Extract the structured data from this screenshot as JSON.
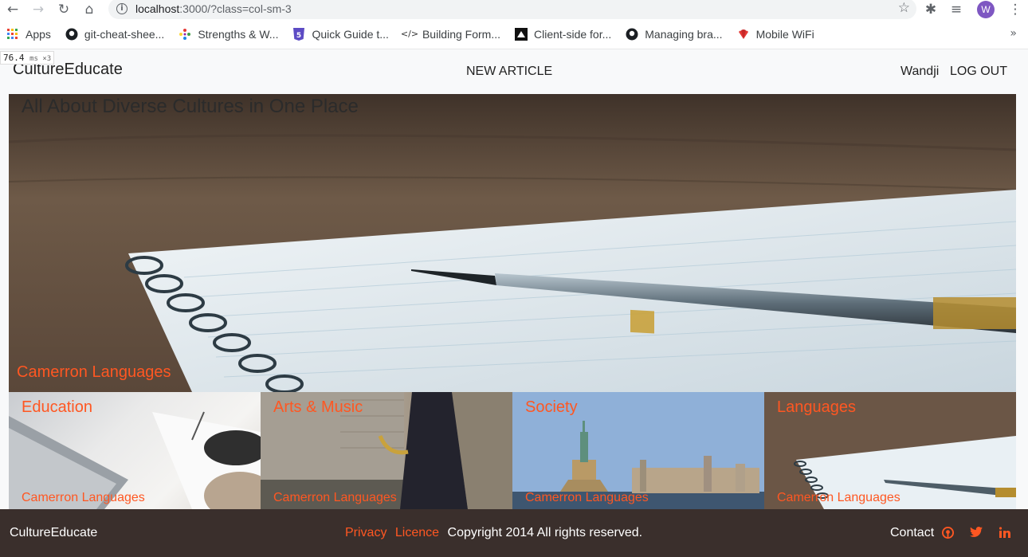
{
  "browser": {
    "url_host": "localhost",
    "url_path": ":3000/?class=col-sm-3",
    "avatar_letter": "W",
    "bookmarks": [
      {
        "label": "Apps",
        "icon": "apps-grid-icon"
      },
      {
        "label": "git-cheat-shee...",
        "icon": "github-icon"
      },
      {
        "label": "Strengths & W...",
        "icon": "colorful-dots-icon"
      },
      {
        "label": "Quick Guide t...",
        "icon": "html5-icon"
      },
      {
        "label": "Building Form...",
        "icon": "code-icon"
      },
      {
        "label": "Client-side for...",
        "icon": "mdn-icon"
      },
      {
        "label": "Managing bra...",
        "icon": "github-icon"
      },
      {
        "label": "Mobile WiFi",
        "icon": "huawei-icon"
      }
    ]
  },
  "timing": {
    "value": "76.4",
    "unit": "ms ×3"
  },
  "navbar": {
    "brand": "CultureEducate",
    "new_article": "NEW ARTICLE",
    "user": "Wandji",
    "logout": "LOG OUT"
  },
  "hero": {
    "title": "All About Diverse Cultures in One Place",
    "label": "Camerron Languages"
  },
  "cards": [
    {
      "title": "Education",
      "label": "Camerron Languages"
    },
    {
      "title": "Arts & Music",
      "label": "Camerron Languages"
    },
    {
      "title": "Society",
      "label": "Camerron Languages"
    },
    {
      "title": "Languages",
      "label": "Camerron Languages"
    }
  ],
  "footer": {
    "brand": "CultureEducate",
    "privacy": "Privacy",
    "licence": "Licence",
    "copyright": "Copyright 2014  All rights reserved.",
    "contact": "Contact",
    "social_icons": [
      "github-icon",
      "twitter-icon",
      "linkedin-icon"
    ]
  },
  "colors": {
    "accent": "#ff5722",
    "footer_bg": "#3a2f2c",
    "navbar_bg": "#f8f9fa"
  }
}
